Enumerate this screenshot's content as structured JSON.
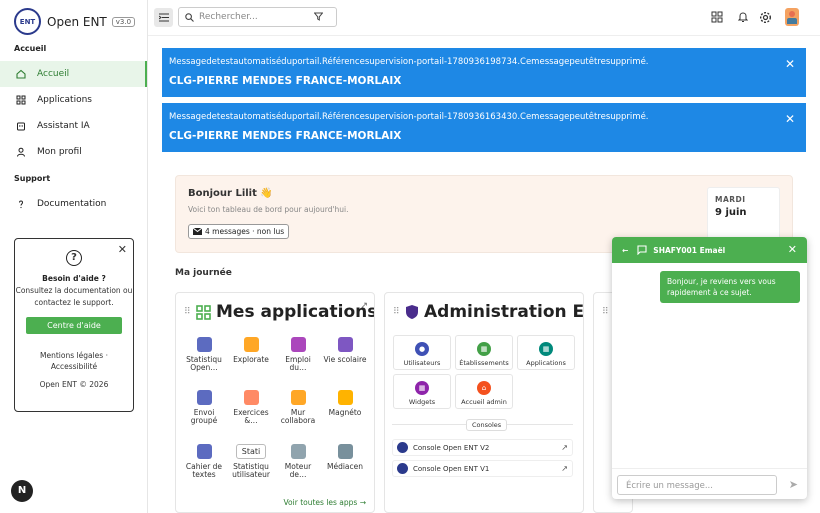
{
  "brand": {
    "logo_text": "ENT",
    "name": "Open ENT",
    "version": "v3.0"
  },
  "sidebar": {
    "section_main": "Accueil",
    "items": [
      {
        "label": "Accueil"
      },
      {
        "label": "Applications"
      },
      {
        "label": "Assistant IA"
      },
      {
        "label": "Mon profil"
      }
    ],
    "section_support": "Support",
    "support_items": [
      {
        "label": "Documentation"
      }
    ]
  },
  "help": {
    "title": "Besoin d'aide ?",
    "desc": "Consultez la documentation ou contactez le support.",
    "button": "Centre d'aide",
    "legal": "Mentions légales ·",
    "access": "Accessibilité",
    "copyright": "Open ENT © 2026"
  },
  "user_initial": "N",
  "search": {
    "placeholder": "Rechercher..."
  },
  "banners": [
    {
      "message": "Messagedetestautomatiséduportail.Référencesupervision-portail-1780936198734.Cemessagepeutêtresupprimé.",
      "school": "CLG-PIERRE MENDES FRANCE-MORLAIX"
    },
    {
      "message": "Messagedetestautomatiséduportail.Référencesupervision-portail-1780936163430.Cemessagepeutêtresupprimé.",
      "school": "CLG-PIERRE MENDES FRANCE-MORLAIX"
    }
  ],
  "welcome": {
    "greeting": "Bonjour Lilit 👋",
    "subtitle": "Voici ton tableau de bord pour aujourd'hui.",
    "messages": "4 messages · non lus",
    "day": "MARDI",
    "date": "9 juin"
  },
  "journee": "Ma journée",
  "apps_card": {
    "title": "Mes applications",
    "apps": [
      {
        "label": "Statistiqu Open…",
        "color": "#5c6bc0"
      },
      {
        "label": "Explorate",
        "color": "#ffa726"
      },
      {
        "label": "Emploi du…",
        "color": "#ab47bc"
      },
      {
        "label": "Vie scolaire",
        "color": "#7e57c2"
      },
      {
        "label": "Envoi groupé",
        "color": "#5c6bc0"
      },
      {
        "label": "Exercices &…",
        "color": "#ff8a65"
      },
      {
        "label": "Mur collabora",
        "color": "#ffa726"
      },
      {
        "label": "Magnéto",
        "color": "#ffb300"
      },
      {
        "label": "Cahier de textes",
        "color": "#5c6bc0"
      },
      {
        "label": "Statistiqu utilisateur",
        "color": "#888888"
      },
      {
        "label": "Moteur de…",
        "color": "#90a4ae"
      },
      {
        "label": "Médiacen",
        "color": "#78909c"
      }
    ],
    "see_all": "Voir toutes les apps →",
    "broken_img_text": "Stati"
  },
  "admin_card": {
    "title": "Administration ENT",
    "buttons": [
      {
        "label": "Utilisateurs",
        "color": "#3f51b5"
      },
      {
        "label": "Établissements",
        "color": "#43a047"
      },
      {
        "label": "Applications",
        "color": "#00897b"
      },
      {
        "label": "Widgets",
        "color": "#8e24aa"
      },
      {
        "label": "Accueil admin",
        "color": "#f4511e"
      }
    ],
    "consoles_label": "Consoles",
    "consoles": [
      {
        "label": "Console Open ENT V2"
      },
      {
        "label": "Console Open ENT V1"
      }
    ]
  },
  "chat": {
    "title": "SHAFY001 Emaël",
    "message": "Bonjour, je reviens vers vous rapidement à ce sujet.",
    "placeholder": "Écrire un message..."
  }
}
